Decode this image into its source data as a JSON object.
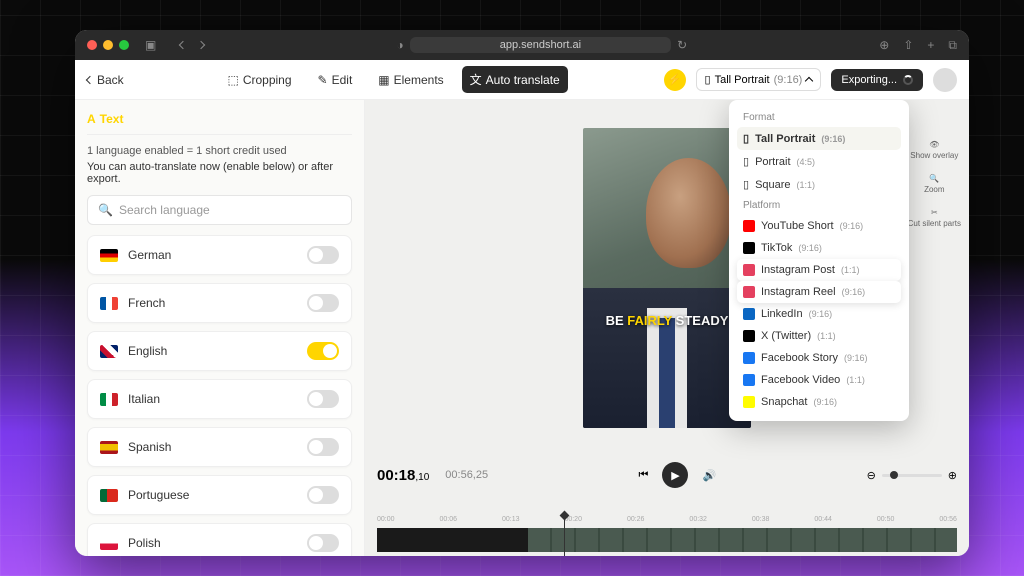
{
  "browser": {
    "url": "app.sendshort.ai"
  },
  "toolbar": {
    "back_label": "Back",
    "cropping": "Cropping",
    "edit": "Edit",
    "elements": "Elements",
    "auto_translate": "Auto translate",
    "format": {
      "name": "Tall Portrait",
      "ratio": "(9:16)"
    },
    "export_label": "Exporting..."
  },
  "sidebar": {
    "tab_label": "Text",
    "info1": "1 language enabled = 1 short credit used",
    "info2": "You can auto-translate now (enable below) or after export.",
    "search_placeholder": "Search language",
    "languages": [
      {
        "name": "German",
        "flag_colors": "linear-gradient(180deg,#000 33%,#dd0000 33% 66%,#ffce00 66%)",
        "enabled": false
      },
      {
        "name": "French",
        "flag_colors": "linear-gradient(90deg,#0055a4 33%,#fff 33% 66%,#ef4135 66%)",
        "enabled": false
      },
      {
        "name": "English",
        "flag_colors": "linear-gradient(45deg,#012169 25%,#c8102e 25% 50%,#fff 50% 75%,#012169 75%)",
        "enabled": true
      },
      {
        "name": "Italian",
        "flag_colors": "linear-gradient(90deg,#008c45 33%,#fff 33% 66%,#cd212a 66%)",
        "enabled": false
      },
      {
        "name": "Spanish",
        "flag_colors": "linear-gradient(180deg,#aa151b 25%,#f1bf00 25% 75%,#aa151b 75%)",
        "enabled": false
      },
      {
        "name": "Portuguese",
        "flag_colors": "linear-gradient(90deg,#046a38 40%,#da291c 40%)",
        "enabled": false
      },
      {
        "name": "Polish",
        "flag_colors": "linear-gradient(180deg,#fff 50%,#dc143c 50%)",
        "enabled": false
      }
    ]
  },
  "dropdown": {
    "section1_label": "Format",
    "formats": [
      {
        "name": "Tall Portrait",
        "ratio": "(9:16)",
        "selected": true
      },
      {
        "name": "Portrait",
        "ratio": "(4:5)"
      },
      {
        "name": "Square",
        "ratio": "(1:1)"
      }
    ],
    "section2_label": "Platform",
    "platforms": [
      {
        "name": "YouTube Short",
        "ratio": "(9:16)",
        "color": "#ff0000"
      },
      {
        "name": "TikTok",
        "ratio": "(9:16)",
        "color": "#000000"
      },
      {
        "name": "Instagram Post",
        "ratio": "(1:1)",
        "color": "#e4405f",
        "hover": true
      },
      {
        "name": "Instagram Reel",
        "ratio": "(9:16)",
        "color": "#e4405f",
        "hover": true
      },
      {
        "name": "LinkedIn",
        "ratio": "(9:16)",
        "color": "#0a66c2"
      },
      {
        "name": "X (Twitter)",
        "ratio": "(1:1)",
        "color": "#000000"
      },
      {
        "name": "Facebook Story",
        "ratio": "(9:16)",
        "color": "#1877f2"
      },
      {
        "name": "Facebook Video",
        "ratio": "(1:1)",
        "color": "#1877f2"
      },
      {
        "name": "Snapchat",
        "ratio": "(9:16)",
        "color": "#fffc00"
      }
    ]
  },
  "video": {
    "caption_pre": "BE ",
    "caption_hl": "FAIRLY ",
    "caption_post": "STEADY"
  },
  "right_tools": {
    "overlay": "Show overlay",
    "zoom": "Zoom",
    "cut": "Cut silent parts"
  },
  "playback": {
    "current": "00:18",
    "current_frac": ",10",
    "duration": "00:56,25",
    "ruler": [
      "00:00",
      "00:06",
      "00:13",
      "00:20",
      "00:26",
      "00:32",
      "00:38",
      "00:44",
      "00:50",
      "00:56"
    ]
  }
}
